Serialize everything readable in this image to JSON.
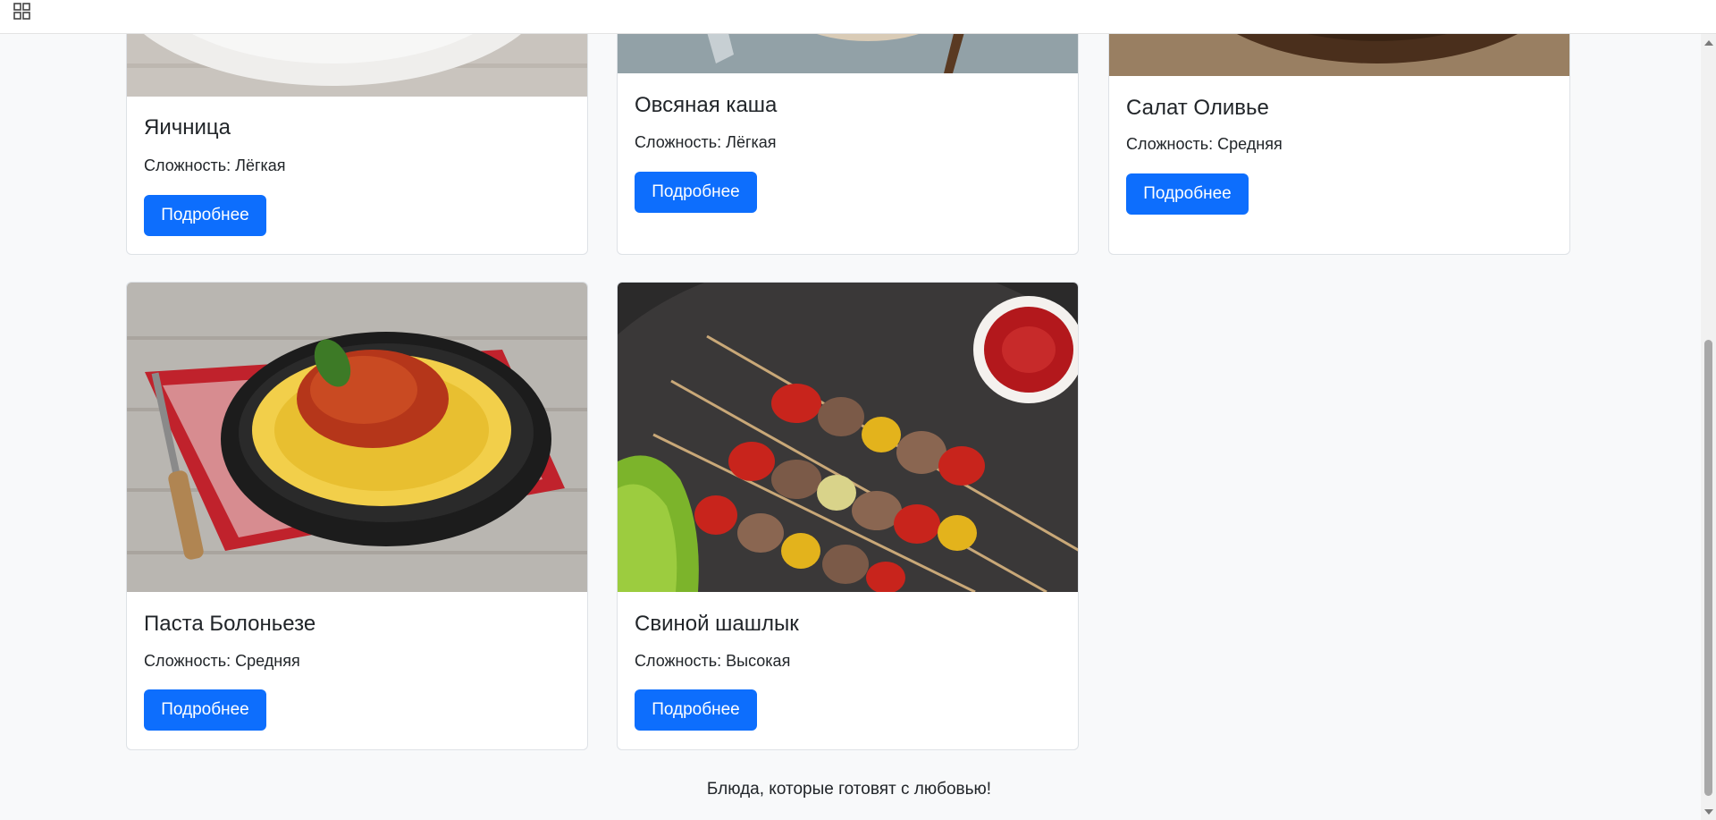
{
  "header": {
    "apps_icon": "grid-apps-icon"
  },
  "cards": [
    {
      "title": "Яичница",
      "difficulty": "Сложность: Лёгкая",
      "button": "Подробнее"
    },
    {
      "title": "Овсяная каша",
      "difficulty": "Сложность: Лёгкая",
      "button": "Подробнее"
    },
    {
      "title": "Салат Оливье",
      "difficulty": "Сложность: Средняя",
      "button": "Подробнее"
    },
    {
      "title": "Паста Болоньезе",
      "difficulty": "Сложность: Средняя",
      "button": "Подробнее"
    },
    {
      "title": "Свиной шашлык",
      "difficulty": "Сложность: Высокая",
      "button": "Подробнее"
    }
  ],
  "footer": {
    "text": "Блюда, которые готовят с любовью!"
  },
  "colors": {
    "primary": "#0d6efd",
    "background": "#f8f9fa",
    "card_border": "#dee2e6"
  }
}
